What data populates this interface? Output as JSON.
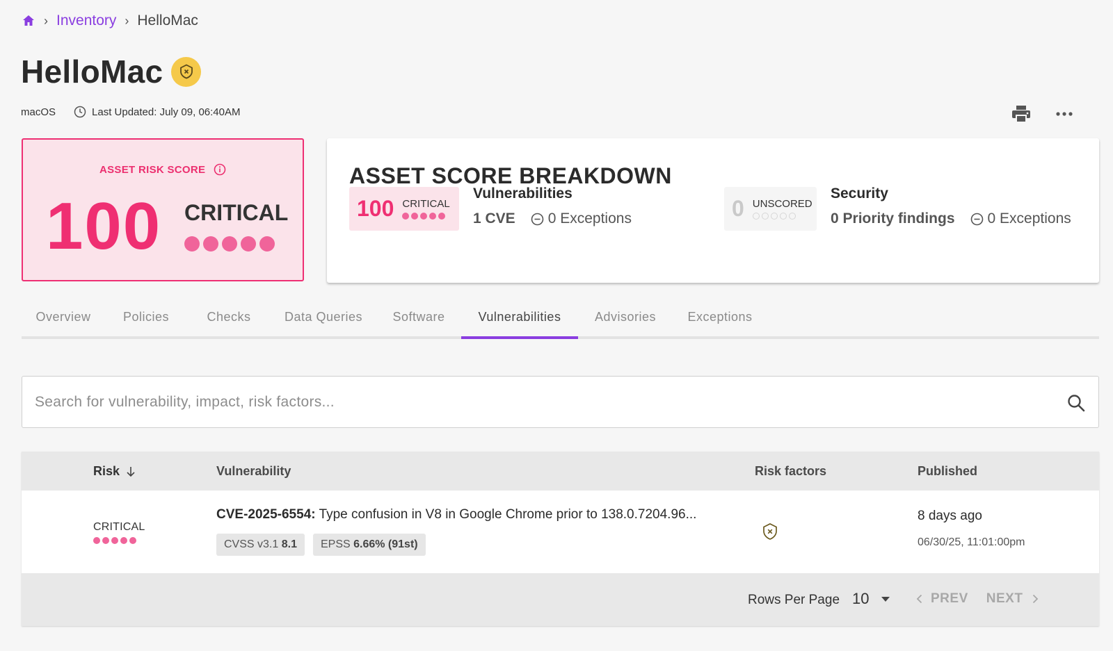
{
  "colors": {
    "accent": "#8a3ee0",
    "critical": "#ef2f72",
    "critical_bg": "#fbe3ea",
    "badge_yellow": "#f5c94a"
  },
  "breadcrumb": {
    "home_icon": "home-icon",
    "items": [
      "Inventory",
      "HelloMac"
    ]
  },
  "asset": {
    "name": "HelloMac",
    "badge_icon": "shield-x-icon",
    "os": "macOS",
    "last_updated": "Last Updated: July 09, 06:40AM"
  },
  "actions": {
    "print_icon": "printer-icon",
    "more_icon": "more-horizontal-icon"
  },
  "risk_score": {
    "label": "ASSET RISK SCORE",
    "value": "100",
    "level": "CRITICAL",
    "dots_filled": 5,
    "dots_total": 5
  },
  "breakdown": {
    "heading": "ASSET SCORE BREAKDOWN",
    "vulnerabilities": {
      "score": "100",
      "level": "CRITICAL",
      "title": "Vulnerabilities",
      "count": "1 CVE",
      "exceptions": "0 Exceptions"
    },
    "security": {
      "score": "0",
      "level": "UNSCORED",
      "title": "Security",
      "count": "0 Priority findings",
      "exceptions": "0 Exceptions"
    }
  },
  "tabs": [
    "Overview",
    "Policies",
    "Checks",
    "Data Queries",
    "Software",
    "Vulnerabilities",
    "Advisories",
    "Exceptions"
  ],
  "active_tab": "Vulnerabilities",
  "search": {
    "placeholder": "Search for vulnerability, impact, risk factors..."
  },
  "table": {
    "columns": {
      "risk": "Risk",
      "vulnerability": "Vulnerability",
      "risk_factors": "Risk factors",
      "published": "Published"
    },
    "rows": [
      {
        "risk_level": "CRITICAL",
        "cve_id": "CVE-2025-6554:",
        "description": "Type confusion in V8 in Google Chrome prior to 138.0.7204.96...",
        "cvss_label": "CVSS v3.1",
        "cvss_value": "8.1",
        "epss_label": "EPSS",
        "epss_value": "6.66% (91st)",
        "risk_factor_icon": "shield-x-icon",
        "published_relative": "8 days ago",
        "published_absolute": "06/30/25, 11:01:00pm"
      }
    ],
    "footer": {
      "rows_per_page_label": "Rows Per Page",
      "rows_per_page": "10",
      "prev": "PREV",
      "next": "NEXT"
    }
  }
}
